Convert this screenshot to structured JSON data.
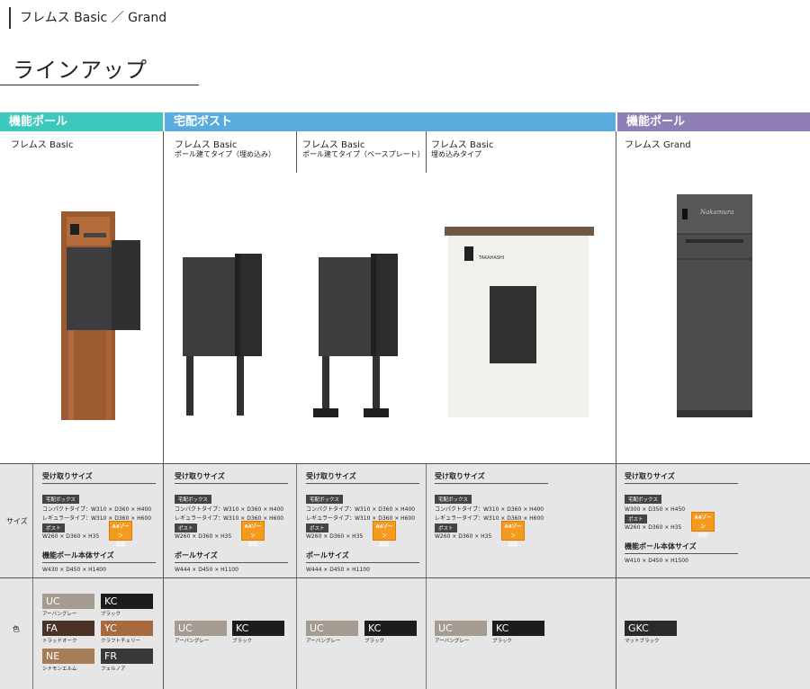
{
  "breadcrumb": "フレムス Basic ／ Grand",
  "page_title": "ラインアップ",
  "categories": {
    "green": "機能ポール",
    "blue": "宅配ボスト",
    "purple": "機能ポール"
  },
  "products": [
    {
      "name": "フレムス Basic",
      "sub": ""
    },
    {
      "name": "フレムス Basic",
      "sub": "ポール建てタイプ（埋め込み）"
    },
    {
      "name": "フレムス Basic",
      "sub": "ポール建てタイプ（ベースプレート）"
    },
    {
      "name": "フレムス Basic",
      "sub": "埋め込みタイプ"
    },
    {
      "name": "フレムス Grand",
      "sub": ""
    }
  ],
  "row_labels": {
    "size": "サイズ",
    "color": "色"
  },
  "image_text": {
    "nameplate_brand": "TAKAHASHI",
    "grand_signature": "Nakamura"
  },
  "specs": {
    "receive_label": "受け取りサイズ",
    "delivery_tag": "宅配ボックス",
    "post_tag": "ポスト",
    "compact": "コンパクトタイプ：W310 × D360 × H400",
    "regular": "レギュラータイプ：W310 × D360 × H600",
    "post_size": "W260 × D360 × H35",
    "badge_line1": "A4ゾーン",
    "badge_line2": "対応",
    "pole_body_label": "機能ポール本体サイズ",
    "pole_body_basic": "W430 × D450 × H1400",
    "pole_label": "ポールサイズ",
    "pole_size": "W444 × D450 × H1100",
    "grand_delivery": "W300 × D350 × H450",
    "grand_post": "W260 × D360 × H35",
    "grand_body": "W410 × D450 × H1500"
  },
  "colors": {
    "UC": {
      "code": "UC",
      "name": "アーバングレー",
      "hex": "#a59b91"
    },
    "KC": {
      "code": "KC",
      "name": "ブラック",
      "hex": "#1c1c1c"
    },
    "FA": {
      "code": "FA",
      "name": "トラッドオーク",
      "hex": "#4a3226"
    },
    "YC": {
      "code": "YC",
      "name": "クラフトチェリー",
      "hex": "#a66a3e"
    },
    "NE": {
      "code": "NE",
      "name": "シナモンエルム",
      "hex": "#a57d58"
    },
    "FR": {
      "code": "FR",
      "name": "フェルノア",
      "hex": "#3a3836"
    },
    "GKC": {
      "code": "GKC",
      "name": "マットブラック",
      "hex": "#2a2a2a"
    }
  }
}
